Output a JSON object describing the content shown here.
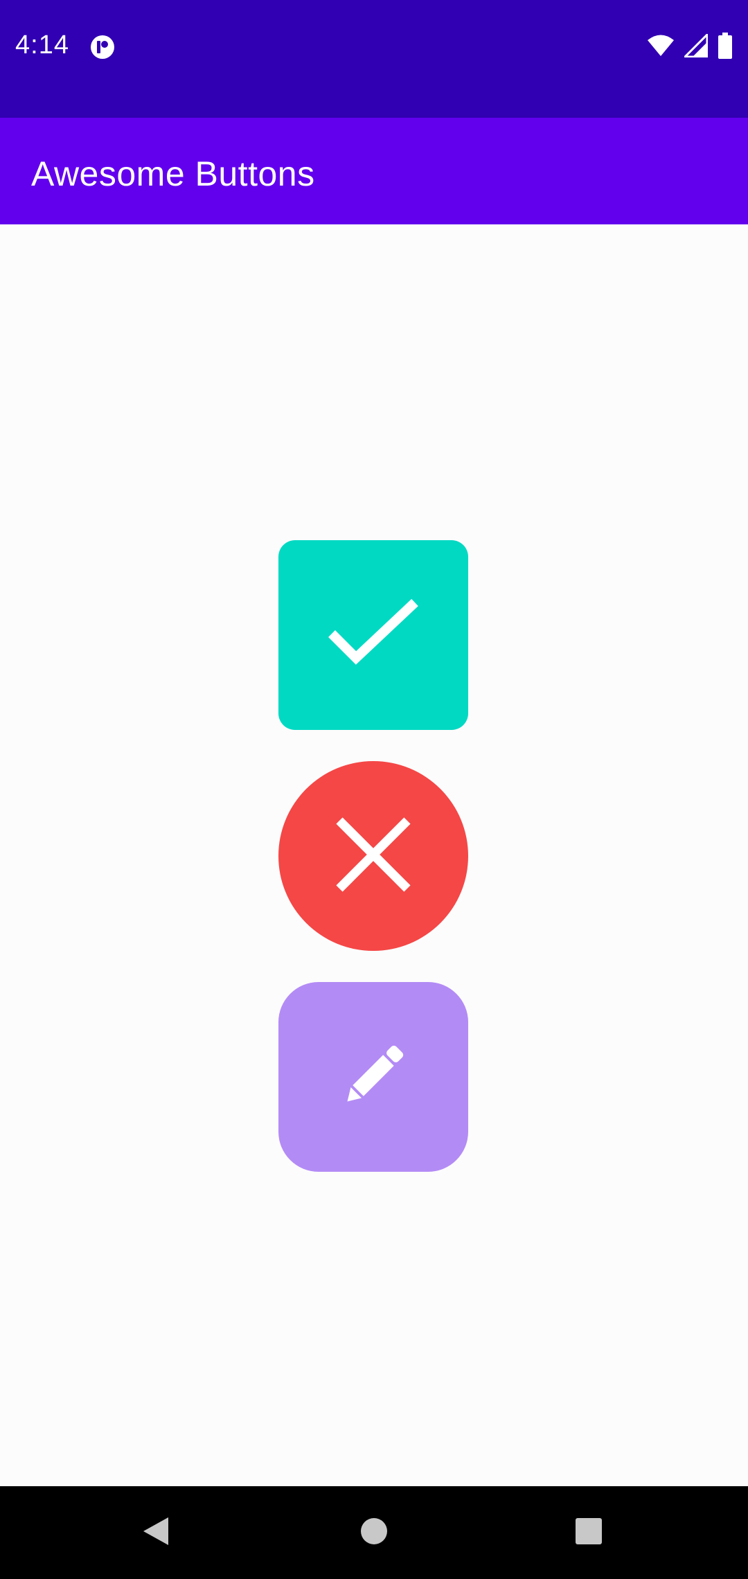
{
  "status_bar": {
    "time": "4:14",
    "app_icon": "app-notification-icon",
    "icons": [
      "wifi-icon",
      "cellular-signal-icon",
      "battery-icon"
    ],
    "background": "#3100b3"
  },
  "app_bar": {
    "title": "Awesome Buttons",
    "background": "#6200ee"
  },
  "buttons": [
    {
      "icon": "check-icon",
      "color": "#02d9c3",
      "shape": "rounded-square"
    },
    {
      "icon": "close-icon",
      "color": "#f44746",
      "shape": "circle"
    },
    {
      "icon": "pencil-icon",
      "color": "#b38bf5",
      "shape": "squircle"
    }
  ],
  "navigation_bar": {
    "icons": [
      "back-icon",
      "home-icon",
      "recents-icon"
    ]
  }
}
